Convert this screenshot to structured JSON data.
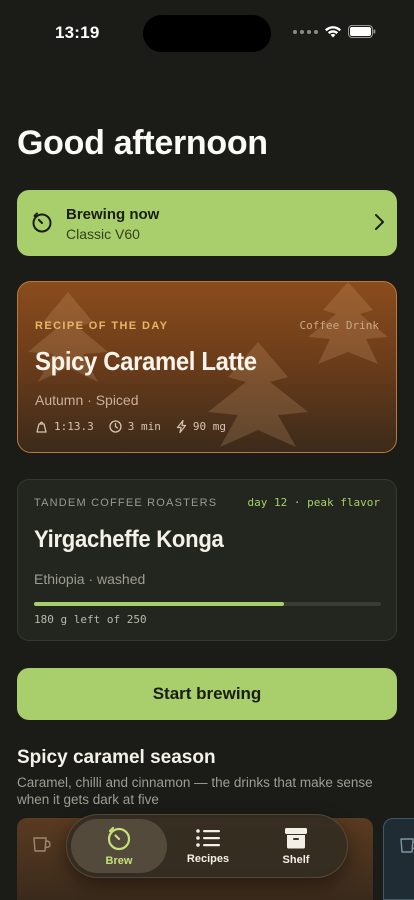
{
  "status_bar": {
    "time": "13:19"
  },
  "greeting": "Good afternoon",
  "brewing_now": {
    "title": "Brewing now",
    "subtitle": "Classic V60"
  },
  "recipe_of_day": {
    "label": "RECIPE OF THE DAY",
    "tag": "Coffee Drink",
    "title": "Spicy Caramel Latte",
    "subtitle": "Autumn · Spiced",
    "time": "1:13.3",
    "duration": "3 min",
    "caffeine": "90 mg"
  },
  "beans": {
    "roaster": "TANDEM COFFEE ROASTERS",
    "day_status": "day 12 · peak flavor",
    "name": "Yirgacheffe Konga",
    "origin": "Ethiopia · washed",
    "remaining_fraction": 0.72,
    "remaining_text": "180 g left of 250"
  },
  "start_button": "Start brewing",
  "section": {
    "title": "Spicy caramel season",
    "description": "Caramel, chilli and cinnamon — the drinks that make sense when it gets dark at five"
  },
  "tab_bar": {
    "tabs": [
      {
        "label": "Brew",
        "icon": "timer-icon",
        "active": true
      },
      {
        "label": "Recipes",
        "icon": "list-icon",
        "active": false
      },
      {
        "label": "Shelf",
        "icon": "archive-box-icon",
        "active": false
      }
    ]
  },
  "colors": {
    "accent": "#a8cf6b",
    "background": "#1b1c18",
    "recipe_accent": "#e9b56a"
  }
}
